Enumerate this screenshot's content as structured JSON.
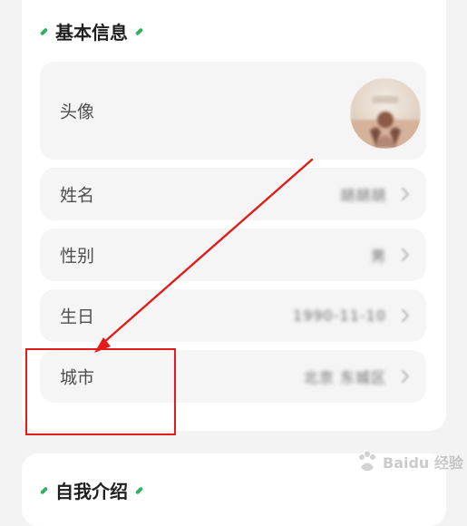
{
  "basic_info": {
    "title": "基本信息",
    "rows": [
      {
        "label": "头像"
      },
      {
        "label": "姓名",
        "value": "胡胡胡"
      },
      {
        "label": "性别",
        "value": "男"
      },
      {
        "label": "生日",
        "value": "1990-11-10"
      },
      {
        "label": "城市",
        "value": "北京 东城区"
      }
    ]
  },
  "intro_section": {
    "title": "自我介绍"
  },
  "colors": {
    "accent_green": "#2fb15e",
    "annotation_red": "#e21b1b"
  },
  "icons": {
    "row_arrow": "chevron-right-icon",
    "section_title_decoration": "leaf-icon"
  }
}
